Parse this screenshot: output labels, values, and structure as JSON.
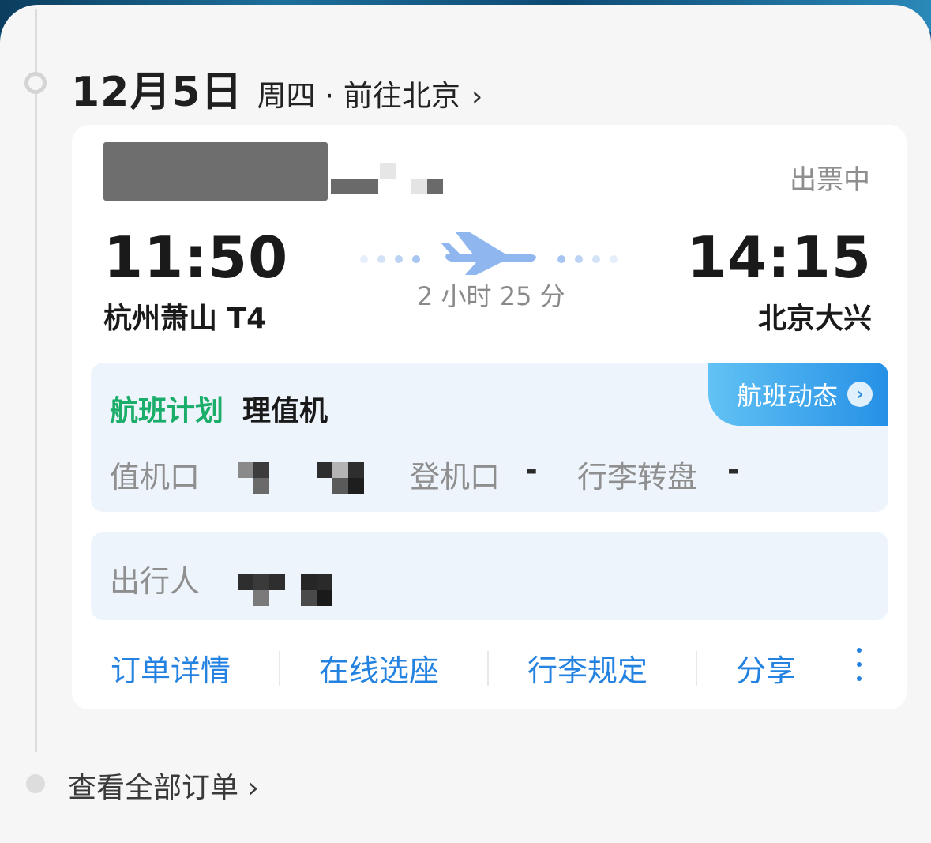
{
  "header": {
    "date": "12月5日",
    "subtitle": "周四 · 前往北京",
    "chevron": "›"
  },
  "card": {
    "status": "出票中",
    "departure": {
      "time": "11:50",
      "airport": "杭州萧山 T4"
    },
    "arrival": {
      "time": "14:15",
      "airport": "北京大兴"
    },
    "duration": "2 小时 25 分",
    "plan": {
      "label": "航班计划",
      "value": "理值机",
      "dynamic_button": "航班动态",
      "dynamic_arrow": "›",
      "checkin_label": "值机口",
      "gate_label": "登机口",
      "gate_value": "-",
      "baggage_label": "行李转盘",
      "baggage_value": "-"
    },
    "passenger": {
      "label": "出行人"
    },
    "actions": [
      "订单详情",
      "在线选座",
      "行李规定",
      "分享"
    ]
  },
  "footer": {
    "view_all": "查看全部订单 ›"
  },
  "colors": {
    "accent_blue": "#2482e0",
    "plan_green": "#1bae6b",
    "status_gray": "#8e8e8e",
    "panel_bg": "#f6f6f6"
  },
  "icons": [
    "airplane-icon",
    "chevron-right-icon",
    "more-vertical-icon"
  ]
}
